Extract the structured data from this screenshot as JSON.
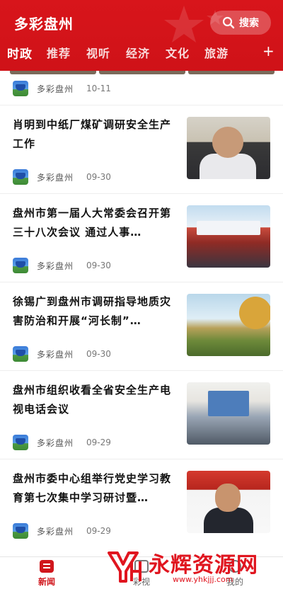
{
  "header": {
    "app_title": "多彩盘州",
    "search_label": "搜索",
    "tabs": [
      {
        "label": "时政",
        "active": true
      },
      {
        "label": "推荐"
      },
      {
        "label": "视听"
      },
      {
        "label": "经济"
      },
      {
        "label": "文化"
      },
      {
        "label": "旅游"
      }
    ],
    "add_tab": "+"
  },
  "partial_item": {
    "source": "多彩盘州",
    "date": "10-11"
  },
  "articles": [
    {
      "title": "肖明到中纸厂煤矿调研安全生产工作",
      "source": "多彩盘州",
      "date": "09-30"
    },
    {
      "title": "盘州市第一届人大常委会召开第三十八次会议 通过人事…",
      "source": "多彩盘州",
      "date": "09-30"
    },
    {
      "title": "徐锡广到盘州市调研指导地质灾害防治和开展“河长制”…",
      "source": "多彩盘州",
      "date": "09-30"
    },
    {
      "title": "盘州市组织收看全省安全生产电视电话会议",
      "source": "多彩盘州",
      "date": "09-29"
    },
    {
      "title": "盘州市委中心组举行党史学习教育第七次集中学习研讨暨…",
      "source": "多彩盘州",
      "date": "09-29"
    }
  ],
  "bottom_nav": [
    {
      "label": "新闻",
      "active": true,
      "icon": "news-icon"
    },
    {
      "label": "彩视",
      "icon": "video-icon"
    },
    {
      "label": "我的",
      "icon": "profile-icon"
    }
  ],
  "watermark": {
    "text": "永辉资源网",
    "url": "www.yhkjjj.com"
  },
  "colors": {
    "brand_red": "#d0161c",
    "header_red": "#d8151b"
  }
}
